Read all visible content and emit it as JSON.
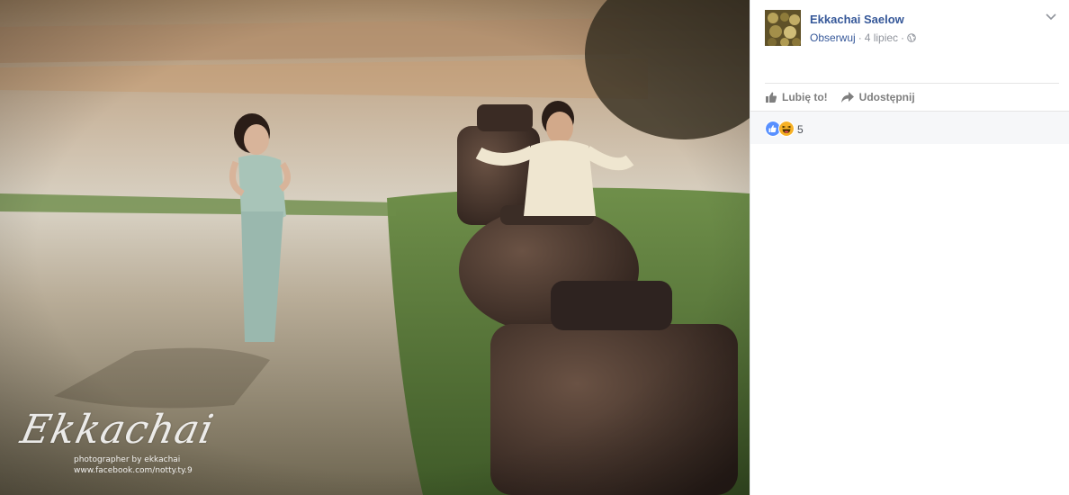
{
  "post": {
    "photo": {
      "watermark": {
        "script_text": "Ekkachai",
        "line1": "photographer by ekkachai",
        "line2": "www.facebook.com/notty.ty.9"
      }
    },
    "author": {
      "name": "Ekkachai Saelow",
      "follow_label": "Obserwuj",
      "separator": "·",
      "date": "4 lipiec",
      "privacy_icon": "globe-icon"
    },
    "options_icon": "chevron-down-icon",
    "actions": {
      "like_label": "Lubię to!",
      "share_label": "Udostępnij"
    },
    "reactions": {
      "count": "5",
      "types": [
        "like",
        "haha"
      ],
      "colors": {
        "like": "#5890ff",
        "haha": "#f7b125"
      }
    }
  },
  "colors": {
    "link": "#365899",
    "meta": "#90949c",
    "action": "#7f7f7f",
    "bar_bg": "#f6f7f9"
  }
}
